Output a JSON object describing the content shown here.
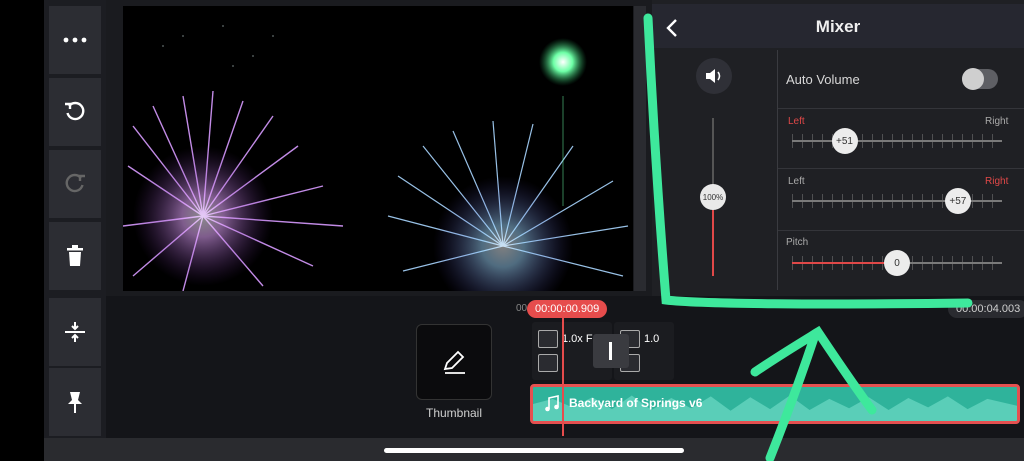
{
  "mixer": {
    "title": "Mixer",
    "auto_volume_label": "Auto Volume",
    "auto_volume_on": false,
    "volume_value": "100%",
    "volume_fraction": 1.0,
    "pan_left": {
      "left_label": "Left",
      "right_label": "Right",
      "value": "+51",
      "level": 0.25
    },
    "pan_right": {
      "left_label": "Left",
      "right_label": "Right",
      "value": "+57",
      "level": 0.79
    },
    "pitch": {
      "label": "Pitch",
      "value": "0",
      "level": 0.5
    }
  },
  "timeline": {
    "current_time": "00:00:00.909",
    "start_time_prefix": "00",
    "end_time": "00:00:04.003",
    "thumbnail_label": "Thumbnail",
    "clip_1_speed": "1.0x F",
    "clip_2_speed": "1.0",
    "audio_title": "Backyard of Springs v6"
  },
  "toolbar": {
    "icons": [
      "more-icon",
      "undo-icon",
      "redo-icon",
      "delete-icon",
      "split-layer-icon",
      "pin-icon"
    ]
  },
  "colors": {
    "accent_red": "#e64c4c",
    "audio_teal": "#2fb39b",
    "annotation_green": "#3ee89c"
  }
}
